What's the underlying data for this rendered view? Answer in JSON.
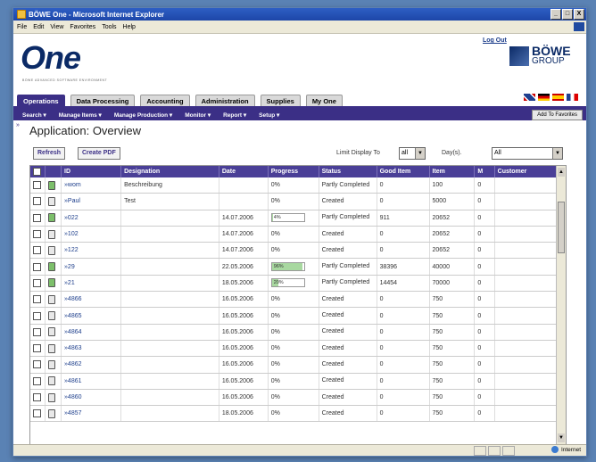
{
  "window": {
    "title": "BÖWE One - Microsoft Internet Explorer",
    "buttons": [
      "_",
      "□",
      "X"
    ]
  },
  "menubar": [
    "File",
    "Edit",
    "View",
    "Favorites",
    "Tools",
    "Help"
  ],
  "header": {
    "logo": "One",
    "logo_sub": "BÖWE ADVANCED SOFTWARE ENVIRONMENT",
    "logout": "Log Out",
    "brand_top": "BÖWE",
    "brand_bottom": "GROUP"
  },
  "tabs": [
    "Operations",
    "Data Processing",
    "Accounting",
    "Administration",
    "Supplies",
    "My One"
  ],
  "subnav": [
    "Search ▾",
    "Manage Items ▾",
    "Manage Production ▾",
    "Monitor ▾",
    "Report ▾",
    "Setup ▾"
  ],
  "add_favorites": "Add To Favorites",
  "page_title": "Application: Overview",
  "buttons": {
    "refresh": "Refresh",
    "create_pdf": "Create PDF"
  },
  "limit": {
    "label": "Limit Display To",
    "value": "all",
    "days_label": "Day(s).",
    "filter_value": "All"
  },
  "columns": [
    "",
    "",
    "ID",
    "Designation",
    "Date",
    "Progress",
    "Status",
    "Good Item",
    "Item",
    "M",
    "Customer"
  ],
  "rows": [
    {
      "id": "»wom",
      "designation": "Beschreibung",
      "date": "",
      "progress": "0%",
      "pct": 0,
      "status": "Partly Completed",
      "good": "0",
      "item": "100",
      "m": "0",
      "green": true
    },
    {
      "id": "»Paul",
      "designation": "Test",
      "date": "",
      "progress": "0%",
      "pct": 0,
      "status": "Created",
      "good": "0",
      "item": "5000",
      "m": "0",
      "green": false
    },
    {
      "id": "»022",
      "designation": "",
      "date": "14.07.2006",
      "progress": "4%",
      "pct": 4,
      "status": "Partly Completed",
      "good": "911",
      "item": "20652",
      "m": "0",
      "green": true,
      "bar": true
    },
    {
      "id": "»102",
      "designation": "",
      "date": "14.07.2006",
      "progress": "0%",
      "pct": 0,
      "status": "Created",
      "good": "0",
      "item": "20652",
      "m": "0",
      "green": false
    },
    {
      "id": "»122",
      "designation": "",
      "date": "14.07.2006",
      "progress": "0%",
      "pct": 0,
      "status": "Created",
      "good": "0",
      "item": "20652",
      "m": "0",
      "green": false
    },
    {
      "id": "»29",
      "designation": "",
      "date": "22.05.2006",
      "progress": "96%",
      "pct": 96,
      "status": "Partly Completed",
      "good": "38396",
      "item": "40000",
      "m": "0",
      "green": true,
      "bar": true
    },
    {
      "id": "»21",
      "designation": "",
      "date": "18.05.2006",
      "progress": "20%",
      "pct": 20,
      "status": "Partly Completed",
      "good": "14454",
      "item": "70000",
      "m": "0",
      "green": true,
      "bar": true
    },
    {
      "id": "»4866",
      "designation": "",
      "date": "16.05.2006",
      "progress": "0%",
      "pct": 0,
      "status": "Created",
      "good": "0",
      "item": "750",
      "m": "0",
      "green": false
    },
    {
      "id": "»4865",
      "designation": "",
      "date": "16.05.2006",
      "progress": "0%",
      "pct": 0,
      "status": "Created",
      "good": "0",
      "item": "750",
      "m": "0",
      "green": false
    },
    {
      "id": "»4864",
      "designation": "",
      "date": "16.05.2006",
      "progress": "0%",
      "pct": 0,
      "status": "Created",
      "good": "0",
      "item": "750",
      "m": "0",
      "green": false
    },
    {
      "id": "»4863",
      "designation": "",
      "date": "16.05.2006",
      "progress": "0%",
      "pct": 0,
      "status": "Created",
      "good": "0",
      "item": "750",
      "m": "0",
      "green": false
    },
    {
      "id": "»4862",
      "designation": "",
      "date": "16.05.2006",
      "progress": "0%",
      "pct": 0,
      "status": "Created",
      "good": "0",
      "item": "750",
      "m": "0",
      "green": false
    },
    {
      "id": "»4861",
      "designation": "",
      "date": "16.05.2006",
      "progress": "0%",
      "pct": 0,
      "status": "Created",
      "good": "0",
      "item": "750",
      "m": "0",
      "green": false
    },
    {
      "id": "»4860",
      "designation": "",
      "date": "16.05.2006",
      "progress": "0%",
      "pct": 0,
      "status": "Created",
      "good": "0",
      "item": "750",
      "m": "0",
      "green": false
    },
    {
      "id": "»4857",
      "designation": "",
      "date": "18.05.2006",
      "progress": "0%",
      "pct": 0,
      "status": "Created",
      "good": "0",
      "item": "750",
      "m": "0",
      "green": false
    }
  ],
  "statusbar": {
    "zone": "Internet"
  }
}
